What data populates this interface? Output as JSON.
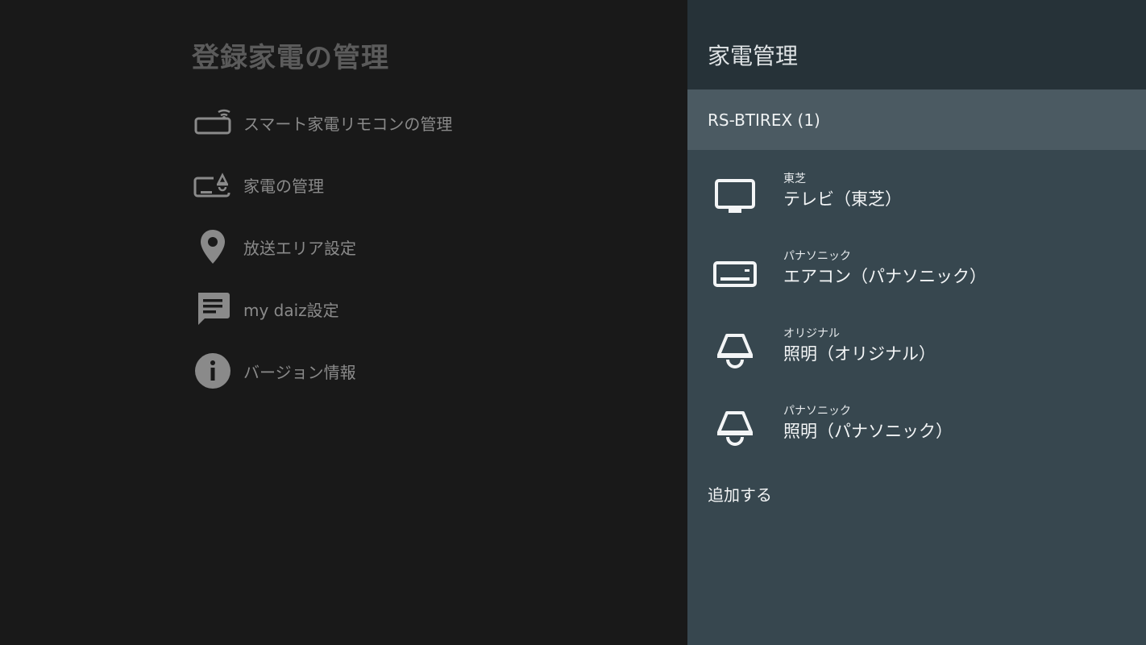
{
  "left": {
    "title": "登録家電の管理",
    "menu": [
      {
        "icon": "remote-device-icon",
        "label": "スマート家電リモコンの管理"
      },
      {
        "icon": "appliance-manage-icon",
        "label": "家電の管理"
      },
      {
        "icon": "location-pin-icon",
        "label": "放送エリア設定"
      },
      {
        "icon": "chat-message-icon",
        "label": "my daiz設定"
      },
      {
        "icon": "info-icon",
        "label": "バージョン情報"
      }
    ]
  },
  "right": {
    "title": "家電管理",
    "group_label": "RS-BTIREX (1)",
    "appliances": [
      {
        "icon": "tv-icon",
        "maker": "東芝",
        "name": "テレビ（東芝）"
      },
      {
        "icon": "air-conditioner-icon",
        "maker": "パナソニック",
        "name": "エアコン（パナソニック）"
      },
      {
        "icon": "ceiling-light-icon",
        "maker": "オリジナル",
        "name": "照明（オリジナル）"
      },
      {
        "icon": "ceiling-light-icon",
        "maker": "パナソニック",
        "name": "照明（パナソニック）"
      }
    ],
    "add_label": "追加する"
  },
  "colors": {
    "left_bg": "#191919",
    "left_text": "#8a8a8a",
    "right_bg": "#37474f",
    "right_header_bg": "#263238",
    "group_bg": "#4b5a62"
  }
}
